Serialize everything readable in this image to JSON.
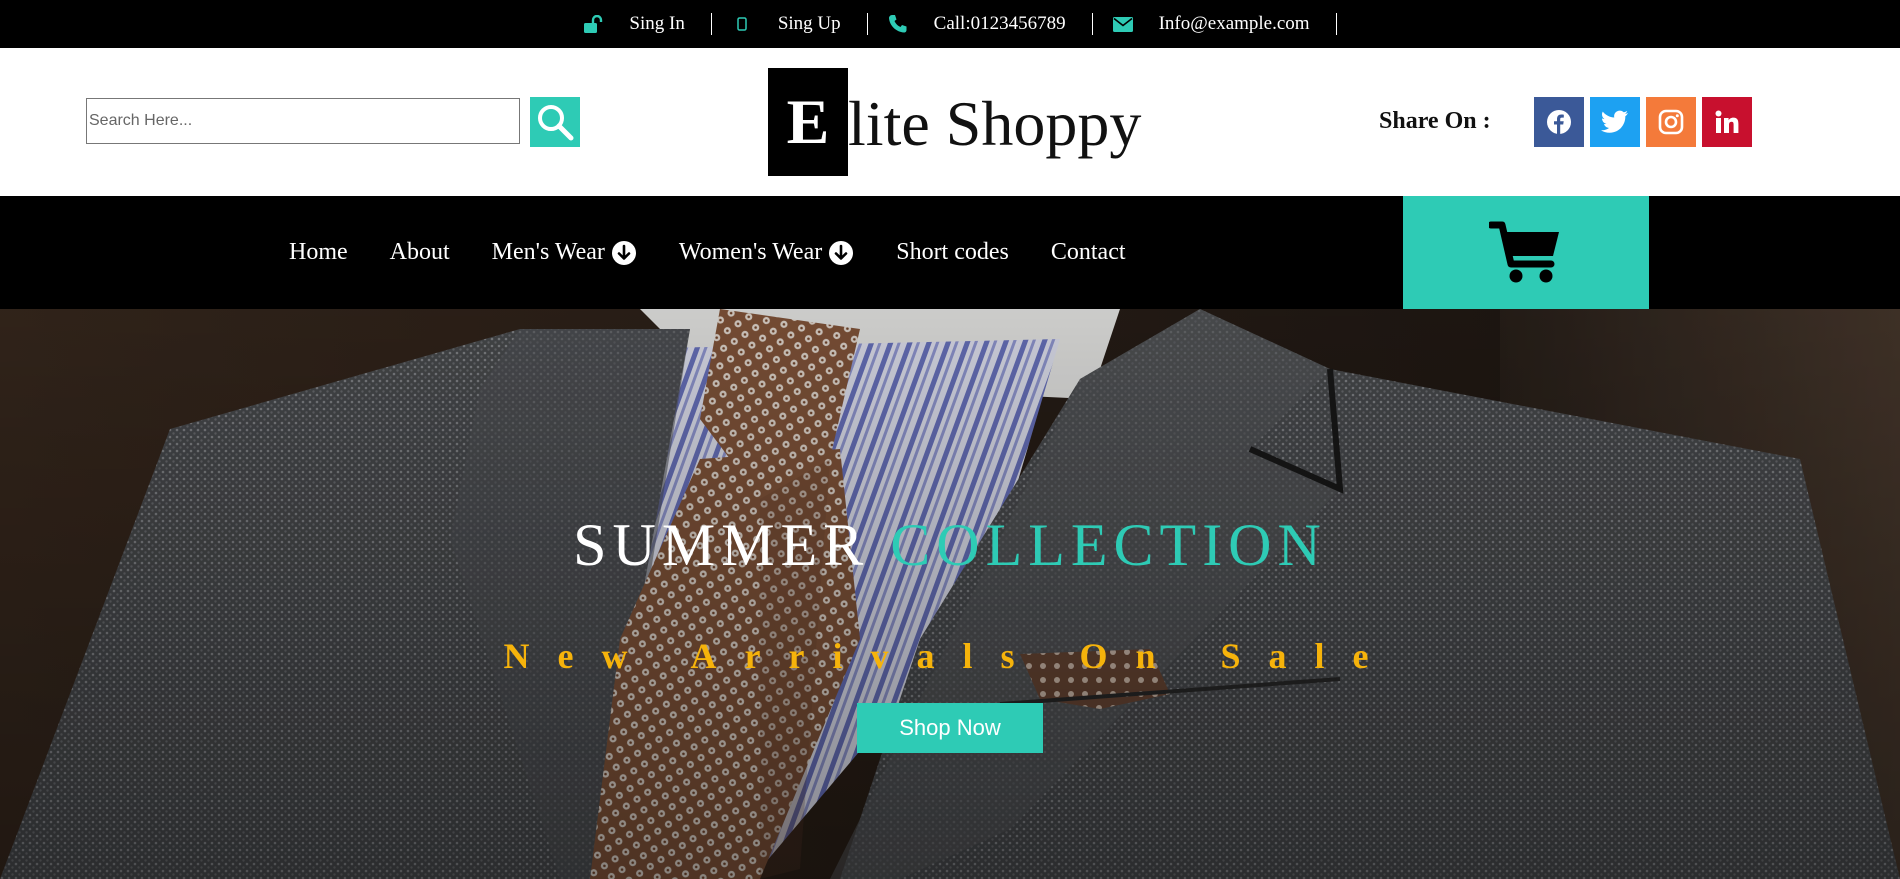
{
  "topbar": {
    "items": [
      {
        "icon": "unlock-icon",
        "label": "Sing In"
      },
      {
        "icon": "mobile-icon",
        "label": "Sing Up"
      },
      {
        "icon": "phone-icon",
        "label": "Call:0123456789"
      },
      {
        "icon": "envelope-icon",
        "label": "Info@example.com"
      }
    ],
    "icon_color": "#2ecbb5"
  },
  "header": {
    "search": {
      "placeholder": "Search Here...",
      "value": ""
    },
    "logo": {
      "initial": "E",
      "rest": "lite Shoppy"
    },
    "share_label": "Share On :",
    "social": [
      {
        "icon": "facebook-icon",
        "color": "#3b5998"
      },
      {
        "icon": "twitter-icon",
        "color": "#1da1f2"
      },
      {
        "icon": "instagram-icon",
        "color": "#f47a3a"
      },
      {
        "icon": "linkedin-icon",
        "color": "#c8102e"
      }
    ]
  },
  "nav": {
    "items": [
      {
        "label": "Home",
        "dropdown": false
      },
      {
        "label": "About",
        "dropdown": false
      },
      {
        "label": "Men's Wear",
        "dropdown": true
      },
      {
        "label": "Women's Wear",
        "dropdown": true
      },
      {
        "label": "Short codes",
        "dropdown": false
      },
      {
        "label": "Contact",
        "dropdown": false
      }
    ],
    "cart_icon": "shopping-cart-icon"
  },
  "hero": {
    "title_part1": "SUMMER",
    "title_part2": "COLLECTION",
    "subtitle": "New Arrivals On Sale",
    "button_label": "Shop Now",
    "accent": "#2ecbb5",
    "subtitle_color": "#f6b30b"
  }
}
